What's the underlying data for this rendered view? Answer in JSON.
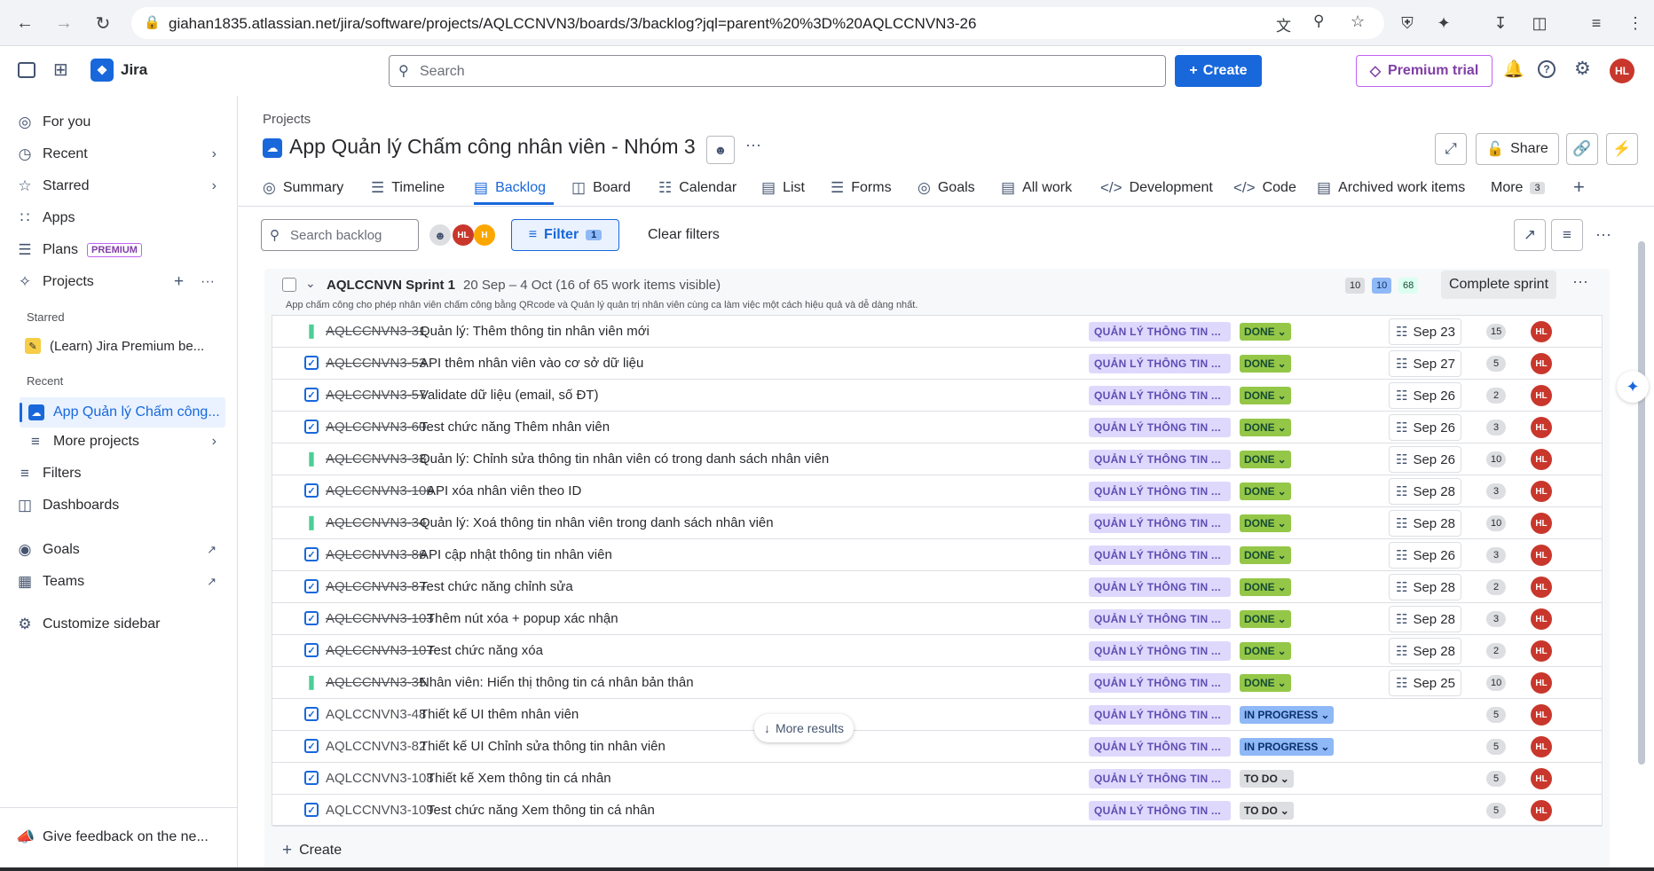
{
  "browser": {
    "url": "giahan1835.atlassian.net/jira/software/projects/AQLCCNVN3/boards/3/backlog?jql=parent%20%3D%20AQLCCNVN3-26"
  },
  "header": {
    "app_name": "Jira",
    "search_placeholder": "Search",
    "create_label": "Create",
    "premium_label": "Premium trial",
    "user_initials": "HL"
  },
  "sidebar": {
    "items": [
      {
        "label": "For you",
        "icon": "target-icon"
      },
      {
        "label": "Recent",
        "icon": "clock-icon"
      },
      {
        "label": "Starred",
        "icon": "star-icon"
      },
      {
        "label": "Apps",
        "icon": "apps-icon"
      },
      {
        "label": "Plans",
        "icon": "plans-icon",
        "tag": "PREMIUM"
      },
      {
        "label": "Projects",
        "icon": "projects-icon"
      }
    ],
    "starred_label": "Starred",
    "starred_project": "(Learn) Jira Premium be...",
    "recent_label": "Recent",
    "recent_project": "App Quản lý Chấm công...",
    "more_projects": "More projects",
    "filters": "Filters",
    "dashboards": "Dashboards",
    "goals": "Goals",
    "teams": "Teams",
    "customize": "Customize sidebar",
    "feedback": "Give feedback on the ne..."
  },
  "project": {
    "breadcrumb": "Projects",
    "title": "App Quản lý Chấm công nhân viên - Nhóm 3",
    "share_label": "Share"
  },
  "tabs": [
    {
      "label": "Summary",
      "icon": "globe-icon"
    },
    {
      "label": "Timeline",
      "icon": "timeline-icon"
    },
    {
      "label": "Backlog",
      "icon": "backlog-icon",
      "active": true
    },
    {
      "label": "Board",
      "icon": "board-icon"
    },
    {
      "label": "Calendar",
      "icon": "calendar-icon"
    },
    {
      "label": "List",
      "icon": "list-icon"
    },
    {
      "label": "Forms",
      "icon": "forms-icon"
    },
    {
      "label": "Goals",
      "icon": "goals-icon"
    },
    {
      "label": "All work",
      "icon": "allwork-icon"
    },
    {
      "label": "Development",
      "icon": "development-icon"
    },
    {
      "label": "Code",
      "icon": "code-icon"
    },
    {
      "label": "Archived work items",
      "icon": "archive-icon"
    }
  ],
  "more_tabs": {
    "label": "More",
    "count": "3"
  },
  "toolbar": {
    "search_placeholder": "Search backlog",
    "avatar1": "HL",
    "avatar2": "H",
    "filter_label": "Filter",
    "filter_count": "1",
    "clear_filters": "Clear filters"
  },
  "sprint": {
    "name": "AQLCCNVN Sprint 1",
    "dates": "20 Sep – 4 Oct (16 of 65 work items visible)",
    "goal": "App chấm công cho phép nhân viên chấm công bằng QRcode và Quản lý quản trị nhân viên cùng ca làm việc một cách hiệu quả và dễ dàng nhất.",
    "count_todo": "10",
    "count_progress": "10",
    "count_done": "68",
    "complete_label": "Complete sprint",
    "more_results": "More results",
    "create_label": "Create"
  },
  "issues": [
    {
      "type": "story",
      "key": "AQLCCNVN3-31",
      "summary": "Quản lý: Thêm thông tin nhân viên mới",
      "epic": "QUẢN LÝ THÔNG TIN ...",
      "status": "DONE",
      "date": "Sep 23",
      "points": "15",
      "assignee": "HL"
    },
    {
      "type": "task",
      "key": "AQLCCNVN3-53",
      "summary": "API thêm nhân viên vào cơ sở dữ liệu",
      "epic": "QUẢN LÝ THÔNG TIN ...",
      "status": "DONE",
      "date": "Sep 27",
      "points": "5",
      "assignee": "HL"
    },
    {
      "type": "task",
      "key": "AQLCCNVN3-57",
      "summary": "Validate dữ liệu (email, số ĐT)",
      "epic": "QUẢN LÝ THÔNG TIN ...",
      "status": "DONE",
      "date": "Sep 26",
      "points": "2",
      "assignee": "HL"
    },
    {
      "type": "task",
      "key": "AQLCCNVN3-60",
      "summary": "Test chức năng Thêm nhân viên",
      "epic": "QUẢN LÝ THÔNG TIN ...",
      "status": "DONE",
      "date": "Sep 26",
      "points": "3",
      "assignee": "HL"
    },
    {
      "type": "story",
      "key": "AQLCCNVN3-33",
      "summary": "Quản lý: Chỉnh sửa thông tin nhân viên có trong danh sách nhân viên",
      "epic": "QUẢN LÝ THÔNG TIN ...",
      "status": "DONE",
      "date": "Sep 26",
      "points": "10",
      "assignee": "HL"
    },
    {
      "type": "task",
      "key": "AQLCCNVN3-106",
      "summary": "API xóa nhân viên theo ID",
      "epic": "QUẢN LÝ THÔNG TIN ...",
      "status": "DONE",
      "date": "Sep 28",
      "points": "3",
      "assignee": "HL"
    },
    {
      "type": "story",
      "key": "AQLCCNVN3-34",
      "summary": "Quản lý: Xoá thông tin nhân viên trong danh sách nhân viên",
      "epic": "QUẢN LÝ THÔNG TIN ...",
      "status": "DONE",
      "date": "Sep 28",
      "points": "10",
      "assignee": "HL"
    },
    {
      "type": "task",
      "key": "AQLCCNVN3-86",
      "summary": "API cập nhật thông tin nhân viên",
      "epic": "QUẢN LÝ THÔNG TIN ...",
      "status": "DONE",
      "date": "Sep 26",
      "points": "3",
      "assignee": "HL"
    },
    {
      "type": "task",
      "key": "AQLCCNVN3-87",
      "summary": "Test chức năng chỉnh sửa",
      "epic": "QUẢN LÝ THÔNG TIN ...",
      "status": "DONE",
      "date": "Sep 28",
      "points": "2",
      "assignee": "HL"
    },
    {
      "type": "task",
      "key": "AQLCCNVN3-103",
      "summary": "Thêm nút xóa + popup xác nhận",
      "epic": "QUẢN LÝ THÔNG TIN ...",
      "status": "DONE",
      "date": "Sep 28",
      "points": "3",
      "assignee": "HL"
    },
    {
      "type": "task",
      "key": "AQLCCNVN3-107",
      "summary": "Test chức năng xóa",
      "epic": "QUẢN LÝ THÔNG TIN ...",
      "status": "DONE",
      "date": "Sep 28",
      "points": "2",
      "assignee": "HL"
    },
    {
      "type": "story",
      "key": "AQLCCNVN3-35",
      "summary": "Nhân viên: Hiển thị thông tin cá nhân bản thân",
      "epic": "QUẢN LÝ THÔNG TIN ...",
      "status": "DONE",
      "date": "Sep 25",
      "points": "10",
      "assignee": "HL"
    },
    {
      "type": "task",
      "key": "AQLCCNVN3-48",
      "summary": "Thiết kế UI thêm nhân viên",
      "epic": "QUẢN LÝ THÔNG TIN ...",
      "status": "IN PROGRESS",
      "date": "",
      "points": "5",
      "assignee": "HL"
    },
    {
      "type": "task",
      "key": "AQLCCNVN3-82",
      "summary": "Thiết kế UI Chỉnh sửa thông tin nhân viên",
      "epic": "QUẢN LÝ THÔNG TIN ...",
      "status": "IN PROGRESS",
      "date": "",
      "points": "5",
      "assignee": "HL"
    },
    {
      "type": "task",
      "key": "AQLCCNVN3-108",
      "summary": "Thiết kế Xem thông tin cá nhân",
      "epic": "QUẢN LÝ THÔNG TIN ...",
      "status": "TO DO",
      "date": "",
      "points": "5",
      "assignee": "HL"
    },
    {
      "type": "task",
      "key": "AQLCCNVN3-109",
      "summary": "Test chức năng Xem thông tin cá nhân",
      "epic": "QUẢN LÝ THÔNG TIN ...",
      "status": "TO DO",
      "date": "",
      "points": "5",
      "assignee": "HL"
    }
  ]
}
